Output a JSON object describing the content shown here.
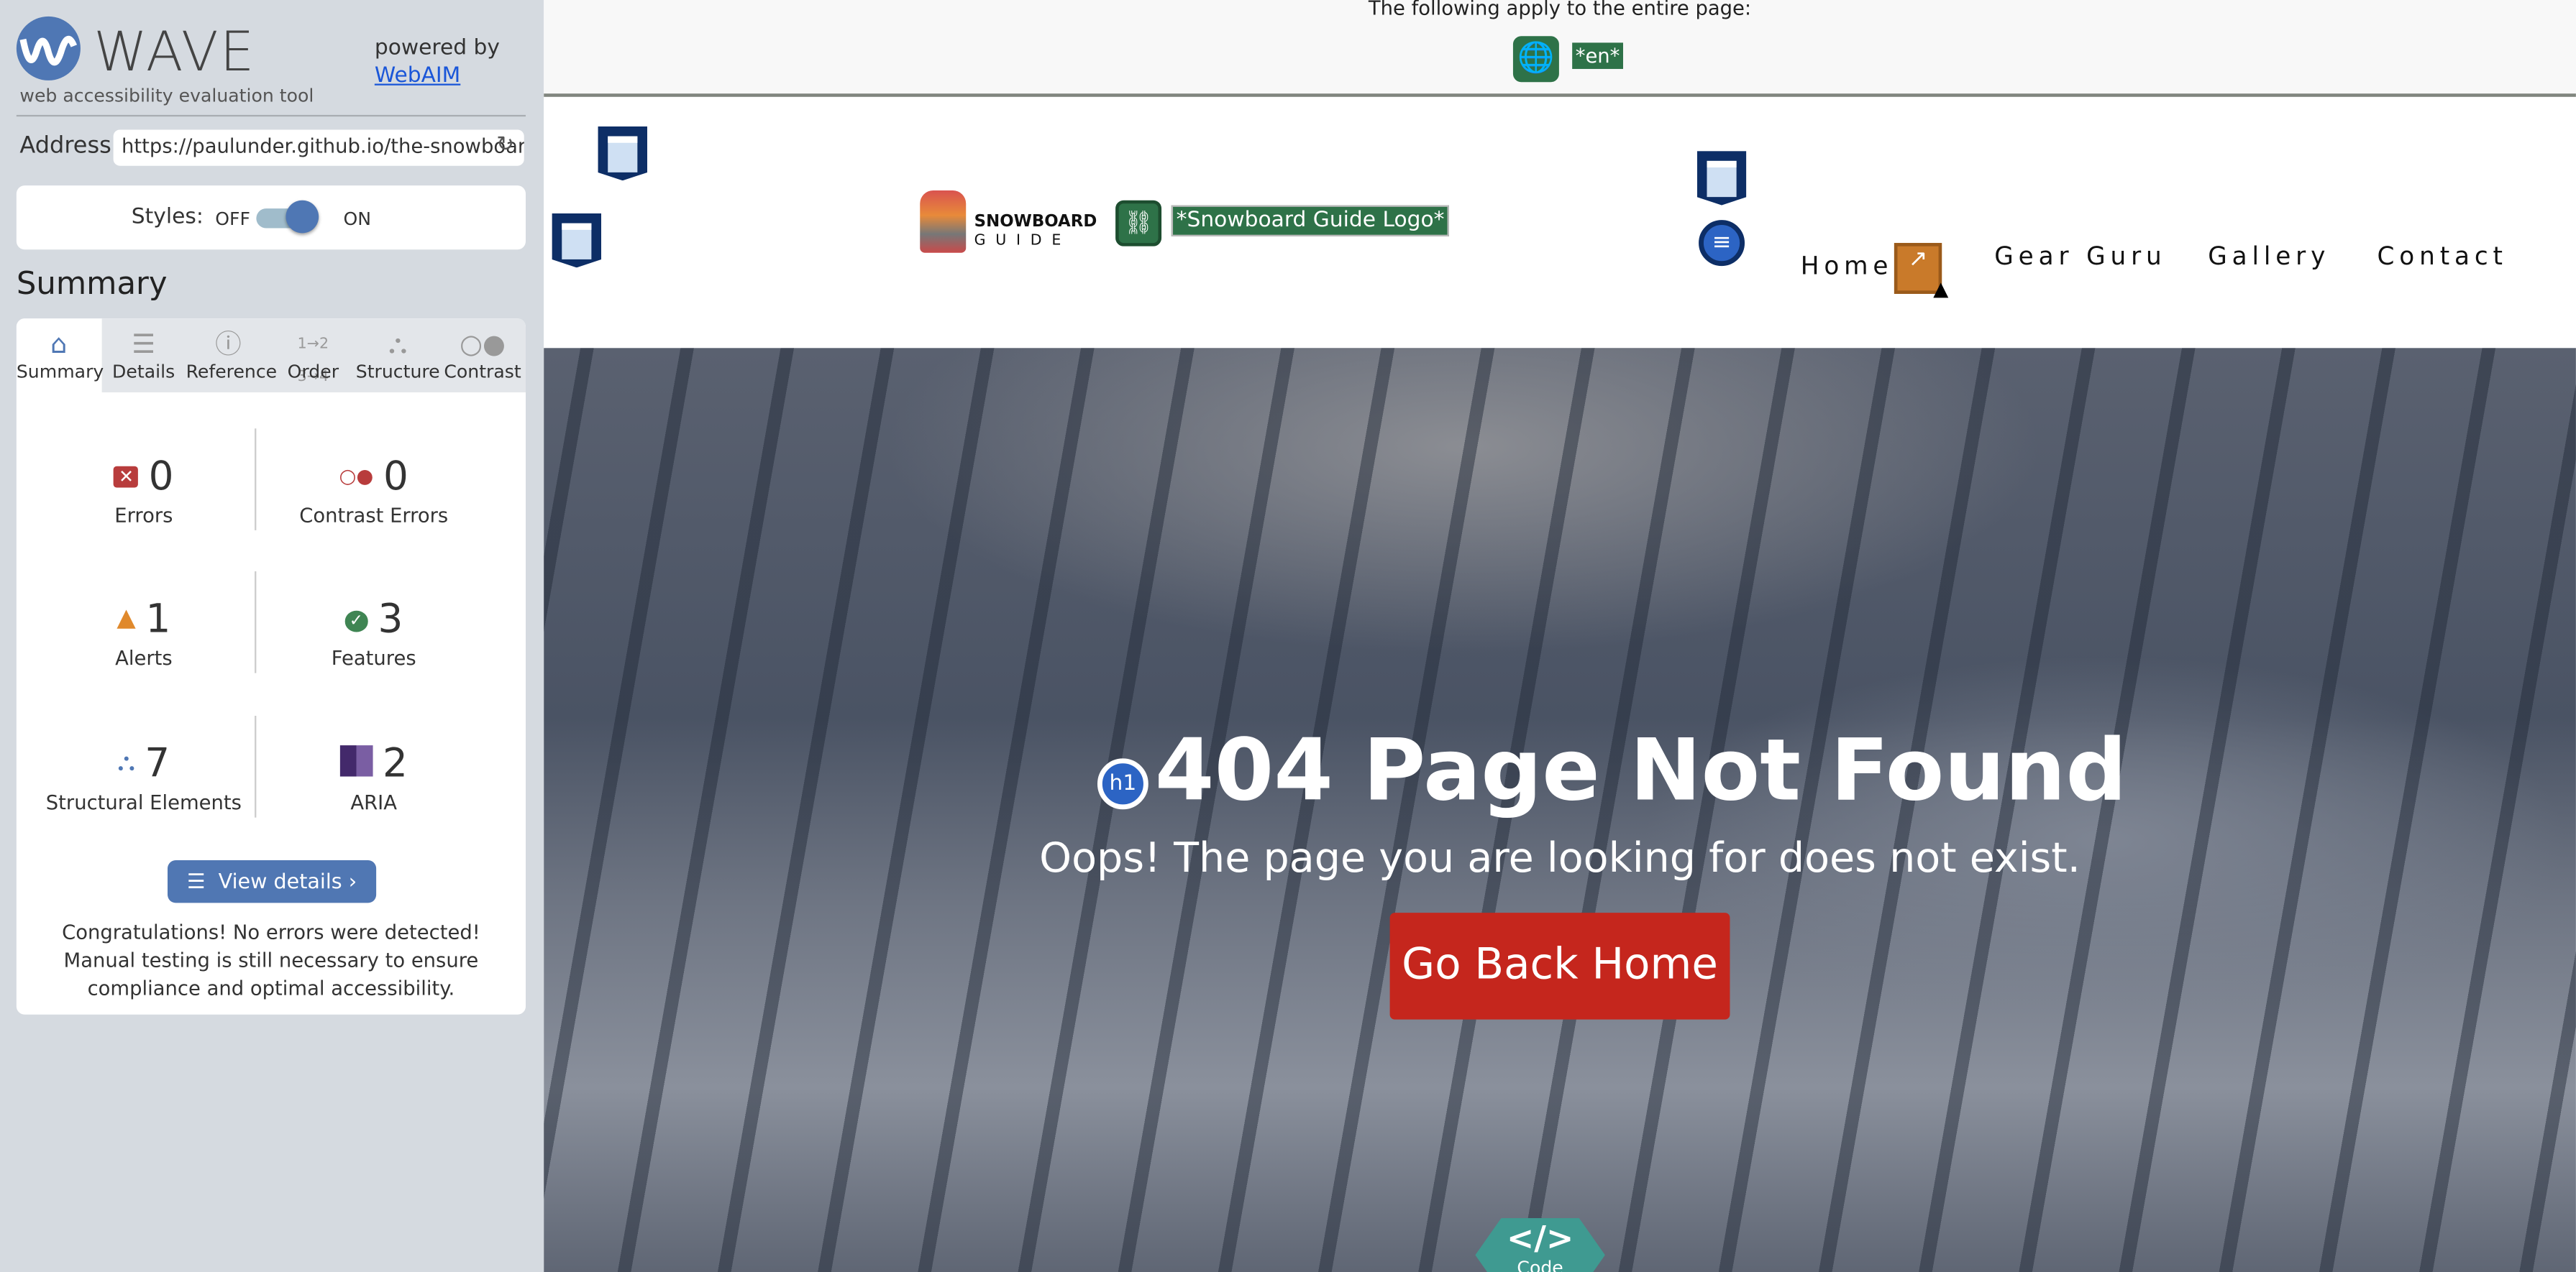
{
  "wave": {
    "logo_text": "WAVE",
    "tagline": "web accessibility evaluation tool",
    "powered_by": "powered by",
    "webaim_link": "WebAIM",
    "address_label": "Address:",
    "address_value": "https://paulunder.github.io/the-snowboar",
    "styles_label": "Styles:",
    "styles_off": "OFF",
    "styles_on": "ON",
    "summary_heading": "Summary",
    "tabs": [
      {
        "label": "Summary",
        "icon": "home-icon"
      },
      {
        "label": "Details",
        "icon": "list-icon"
      },
      {
        "label": "Reference",
        "icon": "info-icon"
      },
      {
        "label": "Order",
        "icon": "order-icon"
      },
      {
        "label": "Structure",
        "icon": "structure-icon"
      },
      {
        "label": "Contrast",
        "icon": "contrast-icon"
      }
    ],
    "stats": {
      "errors": {
        "value": "0",
        "label": "Errors",
        "color": "#b83c3c"
      },
      "contrast_errors": {
        "value": "0",
        "label": "Contrast Errors",
        "color": "#b83c3c"
      },
      "alerts": {
        "value": "1",
        "label": "Alerts",
        "color": "#e0892c"
      },
      "features": {
        "value": "3",
        "label": "Features",
        "color": "#3f8553"
      },
      "structural": {
        "value": "7",
        "label": "Structural Elements",
        "color": "#4f77b4"
      },
      "aria": {
        "value": "2",
        "label": "ARIA",
        "color": "#4b2e7a"
      }
    },
    "view_details": "View details ›",
    "congrats": "Congratulations! No errors were detected! Manual testing is still necessary to ensure compliance and optimal accessibility."
  },
  "page": {
    "banner_text": "The following apply to the entire page:",
    "lang_tag": "*en*",
    "logo_line1": "SNOWBOARD",
    "logo_line2": "GUIDE",
    "logo_alt": "*Snowboard Guide Logo*",
    "nav": [
      "Home",
      "Gear Guru",
      "Gallery",
      "Contact"
    ],
    "h1_badge": "h1",
    "title": "404 Page Not Found",
    "subtitle": "Oops! The page you are looking for does not exist.",
    "button": "Go Back Home",
    "code_toggle_symbol": "</>",
    "code_toggle": "Code"
  }
}
